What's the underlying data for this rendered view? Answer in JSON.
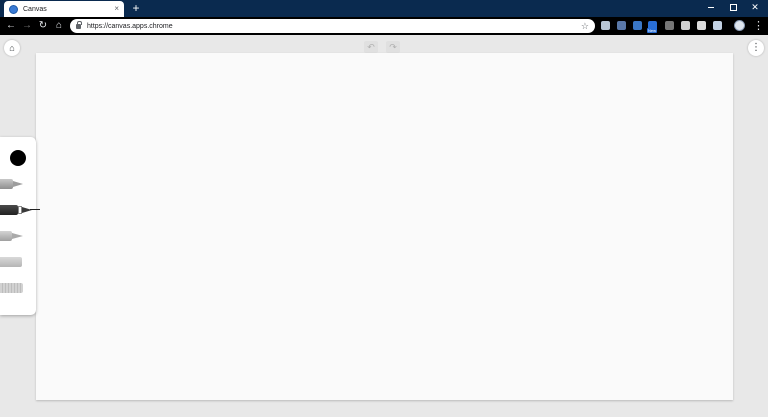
{
  "browser": {
    "tab": {
      "title": "Canvas",
      "close_glyph": "×"
    },
    "new_tab_glyph": "+",
    "window_controls": {
      "close_glyph": "✕"
    },
    "nav": {
      "back_glyph": "←",
      "forward_glyph": "→",
      "reload_glyph": "↻",
      "home_glyph": "⌂"
    },
    "omnibox": {
      "url": "https://canvas.apps.chrome",
      "star_glyph": "☆"
    },
    "extensions": [
      {
        "icon": "shield-extension-icon"
      },
      {
        "icon": "translate-extension-icon"
      },
      {
        "icon": "docs-extension-icon"
      },
      {
        "icon": "new-extension-icon",
        "badge": "New"
      },
      {
        "icon": "extension-icon-5"
      },
      {
        "icon": "extension-icon-6"
      },
      {
        "icon": "extension-icon-7"
      },
      {
        "icon": "extension-icon-8"
      }
    ],
    "menu_glyph": "⋮"
  },
  "app": {
    "home_glyph": "⌂",
    "menu_glyph": "⋮",
    "undo_glyph": "↶",
    "redo_glyph": "↷",
    "palette": {
      "selected_color": "#000000",
      "tools": [
        {
          "name": "pen"
        },
        {
          "name": "marker",
          "selected": true
        },
        {
          "name": "pencil"
        },
        {
          "name": "chalk"
        },
        {
          "name": "eraser"
        }
      ]
    }
  },
  "colors": {
    "titlebar": "#0a2a4f",
    "toolbar": "#000000",
    "app_background": "#e8e8e8",
    "canvas": "#fafafa"
  }
}
